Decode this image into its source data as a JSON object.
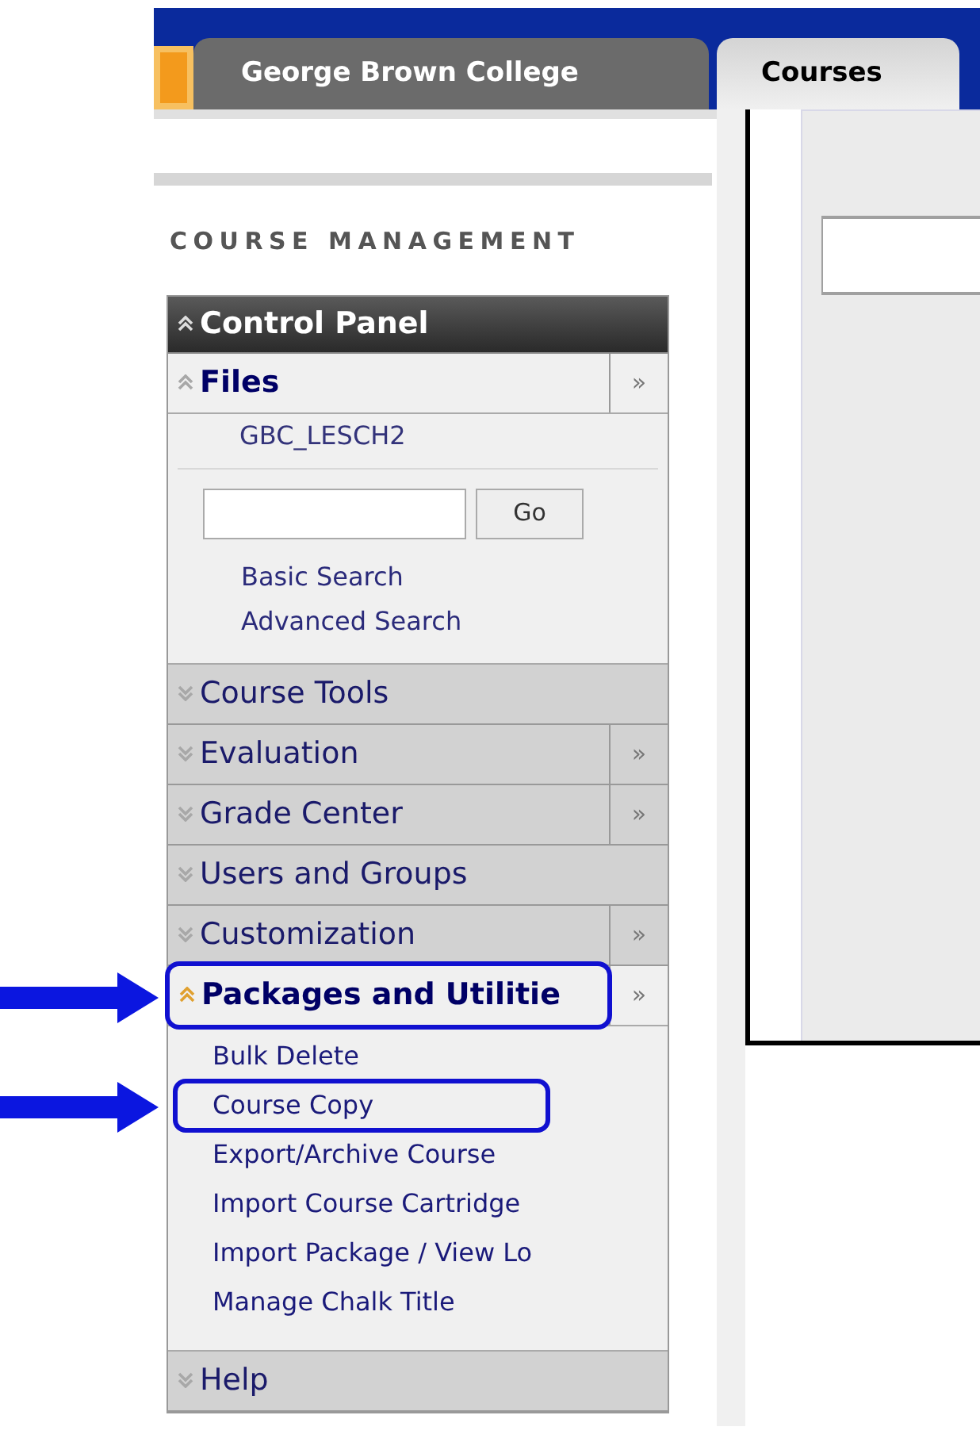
{
  "tabs": [
    {
      "label": "George Brown College",
      "selected": false
    },
    {
      "label": "Courses",
      "selected": true
    }
  ],
  "section_title": "COURSE MANAGEMENT",
  "control_panel": {
    "title": "Control Panel",
    "expanded": true,
    "sections": [
      {
        "kind": "files",
        "label": "Files",
        "expanded": true,
        "more": "»",
        "folder": "GBC_LESCH2",
        "search": {
          "button": "Go"
        },
        "links": [
          "Basic Search",
          "Advanced Search"
        ]
      },
      {
        "kind": "menu",
        "label": "Course Tools",
        "expanded": false
      },
      {
        "kind": "menu",
        "label": "Evaluation",
        "expanded": false,
        "more": "»"
      },
      {
        "kind": "menu",
        "label": "Grade Center",
        "expanded": false,
        "more": "»"
      },
      {
        "kind": "menu",
        "label": "Users and Groups",
        "expanded": false
      },
      {
        "kind": "menu",
        "label": "Customization",
        "expanded": false,
        "more": "»"
      },
      {
        "kind": "menu",
        "label": "Packages and Utilitie",
        "expanded": true,
        "more": "»",
        "highlighted": true,
        "items": [
          {
            "label": "Bulk Delete",
            "highlighted": false
          },
          {
            "label": "Course Copy",
            "highlighted": true
          },
          {
            "label": "Export/Archive Course",
            "highlighted": false
          },
          {
            "label": "Import Course Cartridge",
            "highlighted": false
          },
          {
            "label": "Import Package / View Lo",
            "highlighted": false
          },
          {
            "label": "Manage Chalk Title",
            "highlighted": false
          }
        ]
      },
      {
        "kind": "menu",
        "label": "Help",
        "expanded": false
      }
    ]
  }
}
